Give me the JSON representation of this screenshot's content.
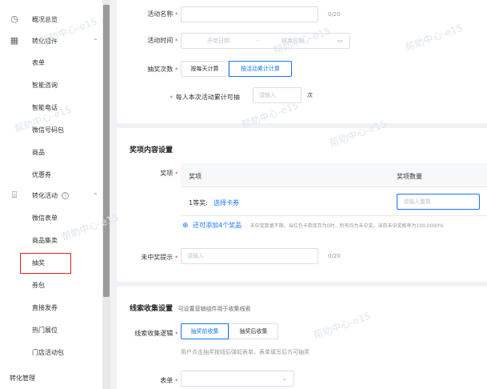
{
  "sidebar": {
    "overview": "概况总览",
    "conversion_components": "转化组件",
    "component_items": [
      "表单",
      "智能咨询",
      "智能电话",
      "微信号码包",
      "商品",
      "优惠券"
    ],
    "conversion_activities": "转化活动",
    "activity_items": [
      "微信表单",
      "商品集卖",
      "抽奖",
      "券包",
      "直接发券",
      "热门展位",
      "门店活动包"
    ],
    "conversion_management": "转化管理",
    "help_icon": "?"
  },
  "form": {
    "activity_name_label": "活动名称",
    "activity_name_counter": "0/20",
    "activity_time_label": "活动时间",
    "start_date_placeholder": "开始日期",
    "date_separator": "-",
    "end_date_placeholder": "结束日期",
    "lottery_count_label": "抽奖次数",
    "daily_count_button": "按每天计算",
    "total_count_button": "按活动累计计算",
    "per_person_label": "每人本次活动累计可抽",
    "per_person_placeholder": "请输入",
    "per_person_unit": "次"
  },
  "prize_section": {
    "title": "奖项内容设置",
    "prize_label": "奖项",
    "column_prize": "奖项",
    "column_quantity": "奖项数量",
    "row_prefix": "1等奖:",
    "select_coupon": "选择卡券",
    "quantity_placeholder": "请输入整数",
    "add_prize": "还可添加4个奖品",
    "prize_note": "未中奖数量不限，当红包卡券库存为0时，所有均为未中奖，当前未中奖概率为100.0000%",
    "no_prize_label": "未中奖提示",
    "no_prize_placeholder": "请输入",
    "no_prize_counter": "0/20"
  },
  "lead_section": {
    "title": "线索收集设置",
    "subtitle": "可设置营销组件用于收集线索",
    "logic_label": "线索收集逻辑",
    "before_button": "抽奖前收集",
    "after_button": "抽奖后收集",
    "logic_hint": "用户点击抽奖按钮后弹起表单，表单填写后方可抽奖",
    "form_label": "表单"
  },
  "watermark": "帮助中心-e15",
  "colors": {
    "accent": "#1677ff",
    "required": "#f56c6c",
    "highlight": "#e02020"
  }
}
